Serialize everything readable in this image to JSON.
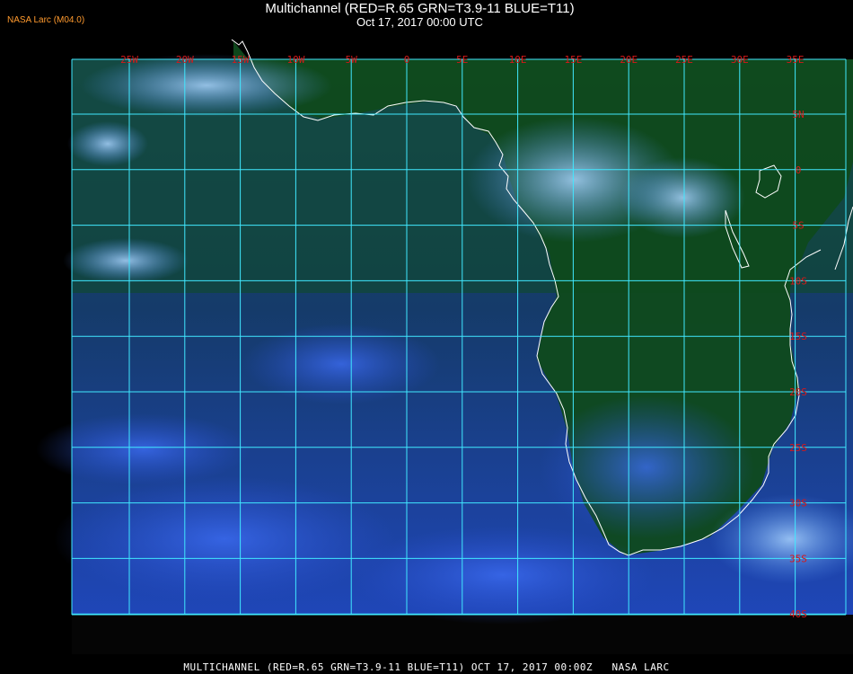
{
  "header": {
    "title": "Multichannel (RED=R.65 GRN=T3.9-11 BLUE=T11)",
    "subtitle": "Oct 17, 2017 00:00 UTC",
    "credit": "NASA Larc (M04.0)"
  },
  "footer": {
    "caption": "MULTICHANNEL (RED=R.65 GRN=T3.9-11 BLUE=T11) OCT 17, 2017 00:00Z   NASA LARC"
  },
  "map": {
    "longitude_labels": [
      "25W",
      "20W",
      "15W",
      "10W",
      "5W",
      "0",
      "5E",
      "10E",
      "15E",
      "20E",
      "25E",
      "30E",
      "35E"
    ],
    "longitude_values": [
      -25,
      -20,
      -15,
      -10,
      -5,
      0,
      5,
      10,
      15,
      20,
      25,
      30,
      35
    ],
    "latitude_labels": [
      "5N",
      "0",
      "5S",
      "10S",
      "15S",
      "20S",
      "25S",
      "30S",
      "35S",
      "40S"
    ],
    "latitude_values": [
      5,
      0,
      -5,
      -10,
      -15,
      -20,
      -25,
      -30,
      -35,
      -40
    ],
    "lon_range": [
      -30,
      35
    ],
    "lat_range": [
      10,
      -40
    ],
    "colors": {
      "background": "#000000",
      "grid": "#40e8ff",
      "label": "#d81818",
      "coast": "#ffffff",
      "ocean": "#1a4a88",
      "land": "#0f4a1c",
      "cloud": "#5aa0ff"
    }
  }
}
